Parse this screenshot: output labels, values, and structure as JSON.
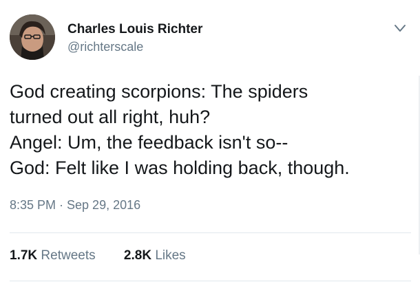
{
  "author": {
    "display_name": "Charles Louis Richter",
    "handle": "@richterscale",
    "avatar_icon": "profile-photo-icon"
  },
  "menu": {
    "icon": "chevron-down-icon"
  },
  "tweet": {
    "lines": [
      "God creating scorpions: The spiders",
      "turned out all right, huh?",
      "Angel: Um, the feedback isn't so--",
      "God: Felt like I was holding back, though."
    ],
    "timestamp": "8:35 PM · Sep 29, 2016"
  },
  "stats": {
    "retweets_count": "1.7K",
    "retweets_label": "Retweets",
    "likes_count": "2.8K",
    "likes_label": "Likes"
  },
  "colors": {
    "text_primary": "#14171a",
    "text_secondary": "#657786",
    "divider": "#e1e8ed",
    "icon": "#657786"
  }
}
